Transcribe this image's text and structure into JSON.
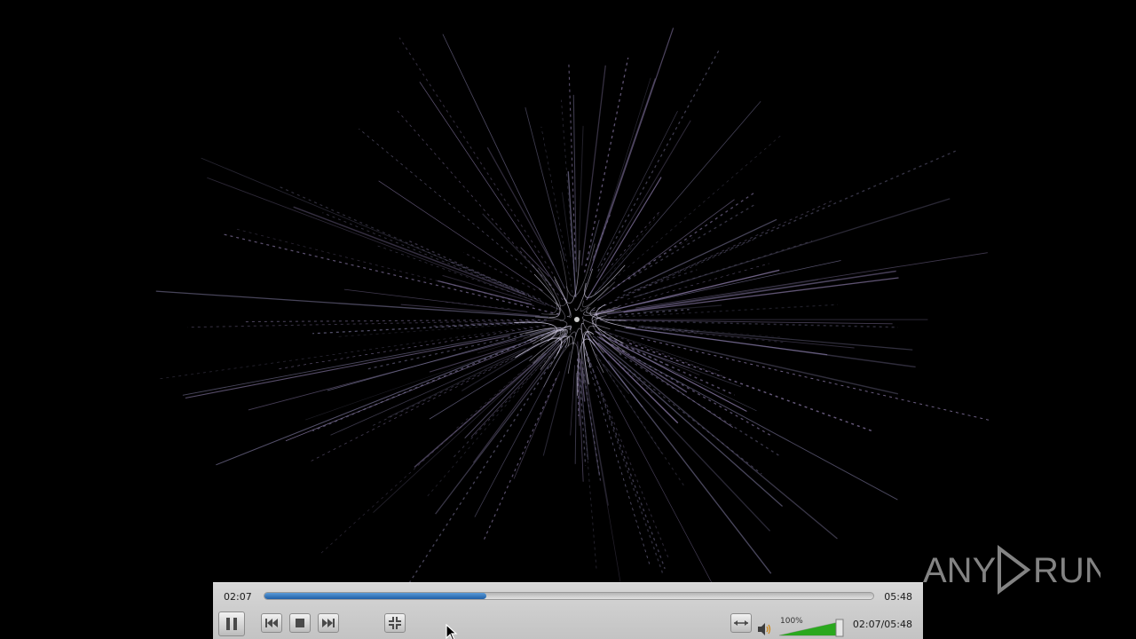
{
  "player": {
    "elapsed": "02:07",
    "total": "05:48",
    "combined_time": "02:07/05:48",
    "progress_fraction": 0.365,
    "volume_label": "100%",
    "volume_fraction": 1.0
  },
  "icons": {
    "pause": "pause-icon",
    "previous": "skip-previous-icon",
    "stop": "stop-icon",
    "next": "skip-next-icon",
    "fullscreen": "exit-fullscreen-icon",
    "loop": "aspect-stretch-icon",
    "volume": "speaker-icon",
    "cursor": "mouse-cursor-icon"
  },
  "watermark": {
    "text_left": "ANY",
    "text_right": "RUN"
  },
  "colors": {
    "seek_fill": "#2f72c0",
    "volume_fill": "#2aa81e",
    "controller_bg": "#cdcdcd"
  }
}
